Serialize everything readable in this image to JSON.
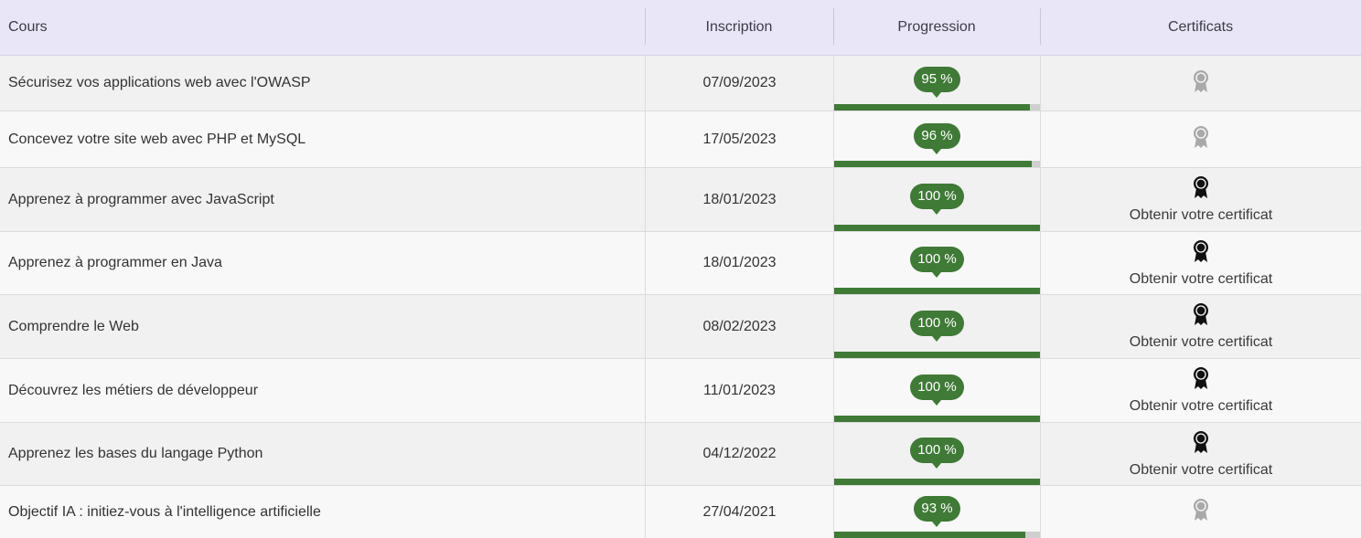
{
  "columns": {
    "course": "Cours",
    "enrollment": "Inscription",
    "progress": "Progression",
    "certificates": "Certificats"
  },
  "colors": {
    "accent": "#3f7a36",
    "header_bg": "#e9e6f7",
    "badge_inactive": "#a9a9a9",
    "badge_active": "#111111"
  },
  "rows": [
    {
      "course": "Sécurisez vos applications web avec l'OWASP",
      "date": "07/09/2023",
      "progress_label": "95 %",
      "progress": 0.95,
      "certificate_available": false,
      "certificate_label": "",
      "icon": "ribbon-badge-icon"
    },
    {
      "course": "Concevez votre site web avec PHP et MySQL",
      "date": "17/05/2023",
      "progress_label": "96 %",
      "progress": 0.96,
      "certificate_available": false,
      "certificate_label": "",
      "icon": "ribbon-badge-icon"
    },
    {
      "course": "Apprenez à programmer avec JavaScript",
      "date": "18/01/2023",
      "progress_label": "100 %",
      "progress": 1.0,
      "certificate_available": true,
      "certificate_label": "Obtenir votre certificat",
      "icon": "ribbon-badge-icon"
    },
    {
      "course": "Apprenez à programmer en Java",
      "date": "18/01/2023",
      "progress_label": "100 %",
      "progress": 1.0,
      "certificate_available": true,
      "certificate_label": "Obtenir votre certificat",
      "icon": "ribbon-badge-icon"
    },
    {
      "course": "Comprendre le Web",
      "date": "08/02/2023",
      "progress_label": "100 %",
      "progress": 1.0,
      "certificate_available": true,
      "certificate_label": "Obtenir votre certificat",
      "icon": "ribbon-badge-icon"
    },
    {
      "course": "Découvrez les métiers de développeur",
      "date": "11/01/2023",
      "progress_label": "100 %",
      "progress": 1.0,
      "certificate_available": true,
      "certificate_label": "Obtenir votre certificat",
      "icon": "ribbon-badge-icon"
    },
    {
      "course": "Apprenez les bases du langage Python",
      "date": "04/12/2022",
      "progress_label": "100 %",
      "progress": 1.0,
      "certificate_available": true,
      "certificate_label": "Obtenir votre certificat",
      "icon": "ribbon-badge-icon"
    },
    {
      "course": "Objectif IA : initiez-vous à l'intelligence artificielle",
      "date": "27/04/2021",
      "progress_label": "93 %",
      "progress": 0.93,
      "certificate_available": false,
      "certificate_label": "",
      "icon": "ribbon-badge-icon"
    }
  ]
}
